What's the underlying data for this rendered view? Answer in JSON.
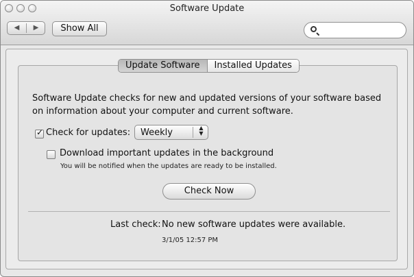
{
  "window": {
    "title": "Software Update"
  },
  "toolbar": {
    "back_symbol": "◀",
    "forward_symbol": "▶",
    "show_all_label": "Show All",
    "search_placeholder": ""
  },
  "tabs": [
    {
      "label": "Update Software",
      "selected": true
    },
    {
      "label": "Installed Updates",
      "selected": false
    }
  ],
  "main": {
    "description": "Software Update checks for new and updated versions of your software based on information about your computer and current software.",
    "check_for_updates": {
      "label": "Check for updates:",
      "checked": true,
      "frequency": "Weekly"
    },
    "background_download": {
      "label": "Download important updates in the background",
      "checked": false,
      "note": "You will be notified when the updates are ready to be installed."
    },
    "check_now_label": "Check Now",
    "last_check_label": "Last check:",
    "last_check_value": "No new software updates were available.",
    "timestamp": "3/1/05 12:57 PM"
  },
  "icons": {
    "close": "close-circle",
    "minimize": "minimize-circle",
    "zoom": "zoom-circle",
    "search": "magnifying-glass",
    "popup": "up-down-arrows"
  },
  "colors": {
    "window_background": "#e8e8e8",
    "panel_background": "#e4e4e4",
    "button_gradient_top": "#fefefe",
    "button_gradient_bottom": "#dadada"
  }
}
